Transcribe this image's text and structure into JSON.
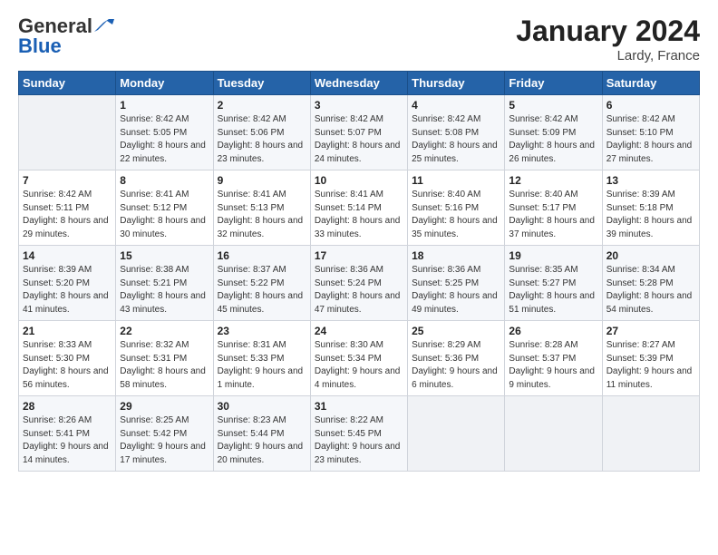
{
  "header": {
    "logo_general": "General",
    "logo_blue": "Blue",
    "title": "January 2024",
    "location": "Lardy, France"
  },
  "weekdays": [
    "Sunday",
    "Monday",
    "Tuesday",
    "Wednesday",
    "Thursday",
    "Friday",
    "Saturday"
  ],
  "weeks": [
    [
      {
        "day": "",
        "sunrise": "",
        "sunset": "",
        "daylight": ""
      },
      {
        "day": "1",
        "sunrise": "Sunrise: 8:42 AM",
        "sunset": "Sunset: 5:05 PM",
        "daylight": "Daylight: 8 hours and 22 minutes."
      },
      {
        "day": "2",
        "sunrise": "Sunrise: 8:42 AM",
        "sunset": "Sunset: 5:06 PM",
        "daylight": "Daylight: 8 hours and 23 minutes."
      },
      {
        "day": "3",
        "sunrise": "Sunrise: 8:42 AM",
        "sunset": "Sunset: 5:07 PM",
        "daylight": "Daylight: 8 hours and 24 minutes."
      },
      {
        "day": "4",
        "sunrise": "Sunrise: 8:42 AM",
        "sunset": "Sunset: 5:08 PM",
        "daylight": "Daylight: 8 hours and 25 minutes."
      },
      {
        "day": "5",
        "sunrise": "Sunrise: 8:42 AM",
        "sunset": "Sunset: 5:09 PM",
        "daylight": "Daylight: 8 hours and 26 minutes."
      },
      {
        "day": "6",
        "sunrise": "Sunrise: 8:42 AM",
        "sunset": "Sunset: 5:10 PM",
        "daylight": "Daylight: 8 hours and 27 minutes."
      }
    ],
    [
      {
        "day": "7",
        "sunrise": "Sunrise: 8:42 AM",
        "sunset": "Sunset: 5:11 PM",
        "daylight": "Daylight: 8 hours and 29 minutes."
      },
      {
        "day": "8",
        "sunrise": "Sunrise: 8:41 AM",
        "sunset": "Sunset: 5:12 PM",
        "daylight": "Daylight: 8 hours and 30 minutes."
      },
      {
        "day": "9",
        "sunrise": "Sunrise: 8:41 AM",
        "sunset": "Sunset: 5:13 PM",
        "daylight": "Daylight: 8 hours and 32 minutes."
      },
      {
        "day": "10",
        "sunrise": "Sunrise: 8:41 AM",
        "sunset": "Sunset: 5:14 PM",
        "daylight": "Daylight: 8 hours and 33 minutes."
      },
      {
        "day": "11",
        "sunrise": "Sunrise: 8:40 AM",
        "sunset": "Sunset: 5:16 PM",
        "daylight": "Daylight: 8 hours and 35 minutes."
      },
      {
        "day": "12",
        "sunrise": "Sunrise: 8:40 AM",
        "sunset": "Sunset: 5:17 PM",
        "daylight": "Daylight: 8 hours and 37 minutes."
      },
      {
        "day": "13",
        "sunrise": "Sunrise: 8:39 AM",
        "sunset": "Sunset: 5:18 PM",
        "daylight": "Daylight: 8 hours and 39 minutes."
      }
    ],
    [
      {
        "day": "14",
        "sunrise": "Sunrise: 8:39 AM",
        "sunset": "Sunset: 5:20 PM",
        "daylight": "Daylight: 8 hours and 41 minutes."
      },
      {
        "day": "15",
        "sunrise": "Sunrise: 8:38 AM",
        "sunset": "Sunset: 5:21 PM",
        "daylight": "Daylight: 8 hours and 43 minutes."
      },
      {
        "day": "16",
        "sunrise": "Sunrise: 8:37 AM",
        "sunset": "Sunset: 5:22 PM",
        "daylight": "Daylight: 8 hours and 45 minutes."
      },
      {
        "day": "17",
        "sunrise": "Sunrise: 8:36 AM",
        "sunset": "Sunset: 5:24 PM",
        "daylight": "Daylight: 8 hours and 47 minutes."
      },
      {
        "day": "18",
        "sunrise": "Sunrise: 8:36 AM",
        "sunset": "Sunset: 5:25 PM",
        "daylight": "Daylight: 8 hours and 49 minutes."
      },
      {
        "day": "19",
        "sunrise": "Sunrise: 8:35 AM",
        "sunset": "Sunset: 5:27 PM",
        "daylight": "Daylight: 8 hours and 51 minutes."
      },
      {
        "day": "20",
        "sunrise": "Sunrise: 8:34 AM",
        "sunset": "Sunset: 5:28 PM",
        "daylight": "Daylight: 8 hours and 54 minutes."
      }
    ],
    [
      {
        "day": "21",
        "sunrise": "Sunrise: 8:33 AM",
        "sunset": "Sunset: 5:30 PM",
        "daylight": "Daylight: 8 hours and 56 minutes."
      },
      {
        "day": "22",
        "sunrise": "Sunrise: 8:32 AM",
        "sunset": "Sunset: 5:31 PM",
        "daylight": "Daylight: 8 hours and 58 minutes."
      },
      {
        "day": "23",
        "sunrise": "Sunrise: 8:31 AM",
        "sunset": "Sunset: 5:33 PM",
        "daylight": "Daylight: 9 hours and 1 minute."
      },
      {
        "day": "24",
        "sunrise": "Sunrise: 8:30 AM",
        "sunset": "Sunset: 5:34 PM",
        "daylight": "Daylight: 9 hours and 4 minutes."
      },
      {
        "day": "25",
        "sunrise": "Sunrise: 8:29 AM",
        "sunset": "Sunset: 5:36 PM",
        "daylight": "Daylight: 9 hours and 6 minutes."
      },
      {
        "day": "26",
        "sunrise": "Sunrise: 8:28 AM",
        "sunset": "Sunset: 5:37 PM",
        "daylight": "Daylight: 9 hours and 9 minutes."
      },
      {
        "day": "27",
        "sunrise": "Sunrise: 8:27 AM",
        "sunset": "Sunset: 5:39 PM",
        "daylight": "Daylight: 9 hours and 11 minutes."
      }
    ],
    [
      {
        "day": "28",
        "sunrise": "Sunrise: 8:26 AM",
        "sunset": "Sunset: 5:41 PM",
        "daylight": "Daylight: 9 hours and 14 minutes."
      },
      {
        "day": "29",
        "sunrise": "Sunrise: 8:25 AM",
        "sunset": "Sunset: 5:42 PM",
        "daylight": "Daylight: 9 hours and 17 minutes."
      },
      {
        "day": "30",
        "sunrise": "Sunrise: 8:23 AM",
        "sunset": "Sunset: 5:44 PM",
        "daylight": "Daylight: 9 hours and 20 minutes."
      },
      {
        "day": "31",
        "sunrise": "Sunrise: 8:22 AM",
        "sunset": "Sunset: 5:45 PM",
        "daylight": "Daylight: 9 hours and 23 minutes."
      },
      {
        "day": "",
        "sunrise": "",
        "sunset": "",
        "daylight": ""
      },
      {
        "day": "",
        "sunrise": "",
        "sunset": "",
        "daylight": ""
      },
      {
        "day": "",
        "sunrise": "",
        "sunset": "",
        "daylight": ""
      }
    ]
  ]
}
